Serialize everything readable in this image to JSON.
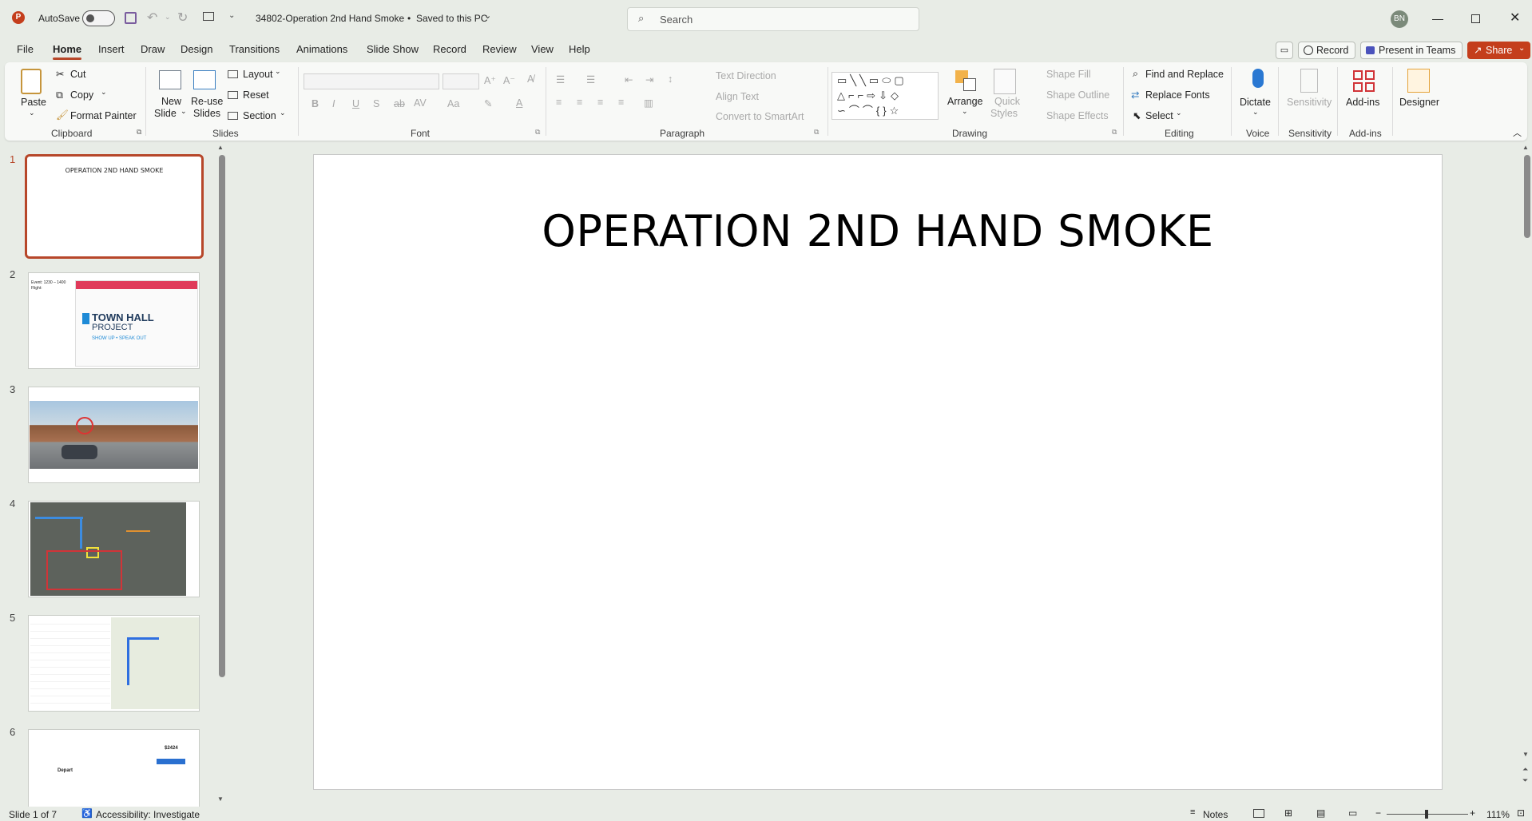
{
  "titlebar": {
    "app_icon": "powerpoint-icon",
    "autosave_label": "AutoSave",
    "autosave_state": "Off",
    "doc_title": "34802-Operation 2nd Hand Smoke",
    "save_status": "Saved to this PC",
    "search_placeholder": "Search",
    "user_initials": "BN"
  },
  "tabs": [
    "File",
    "Home",
    "Insert",
    "Draw",
    "Design",
    "Transitions",
    "Animations",
    "Slide Show",
    "Record",
    "Review",
    "View",
    "Help"
  ],
  "active_tab": "Home",
  "top_right": {
    "record_label": "Record",
    "present_label": "Present in Teams",
    "share_label": "Share"
  },
  "ribbon": {
    "clipboard": {
      "group": "Clipboard",
      "paste": "Paste",
      "cut": "Cut",
      "copy": "Copy",
      "format_painter": "Format Painter"
    },
    "slides": {
      "group": "Slides",
      "new_slide_1": "New",
      "new_slide_2": "Slide",
      "reuse_1": "Re-use",
      "reuse_2": "Slides",
      "layout": "Layout",
      "reset": "Reset",
      "section": "Section"
    },
    "font": {
      "group": "Font"
    },
    "paragraph": {
      "group": "Paragraph",
      "text_direction": "Text Direction",
      "align_text": "Align Text",
      "convert_smartart": "Convert to SmartArt"
    },
    "drawing": {
      "group": "Drawing",
      "arrange": "Arrange",
      "quick_styles_1": "Quick",
      "quick_styles_2": "Styles",
      "shape_fill": "Shape Fill",
      "shape_outline": "Shape Outline",
      "shape_effects": "Shape Effects"
    },
    "editing": {
      "group": "Editing",
      "find_replace": "Find and Replace",
      "replace_fonts": "Replace Fonts",
      "select": "Select"
    },
    "voice": {
      "group": "Voice",
      "dictate": "Dictate"
    },
    "sensitivity": {
      "group": "Sensitivity",
      "sensitivity": "Sensitivity"
    },
    "addins": {
      "group": "Add-ins",
      "addins": "Add-ins"
    },
    "designer": {
      "designer": "Designer"
    }
  },
  "slides_panel": {
    "numbers": [
      "1",
      "2",
      "3",
      "4",
      "5",
      "6"
    ],
    "slide1_title": "OPERATION 2ND HAND SMOKE",
    "slide2_caption_1": "Event: 1230 – 1400",
    "slide2_caption_2": "Flight:",
    "slide2_logo_1": "TOWN HALL",
    "slide2_logo_2": "PROJECT",
    "slide2_tagline": "SHOW UP • SPEAK OUT",
    "slide6_price": "$2424",
    "slide6_depart": "Depart"
  },
  "slide": {
    "title": "OPERATION 2ND HAND SMOKE"
  },
  "status": {
    "slide_counter": "Slide 1 of 7",
    "accessibility": "Accessibility: Investigate",
    "notes": "Notes",
    "zoom": "111%"
  },
  "colors": {
    "accent": "#b7472a",
    "share": "#c43e1c",
    "background": "#e8ece6"
  }
}
